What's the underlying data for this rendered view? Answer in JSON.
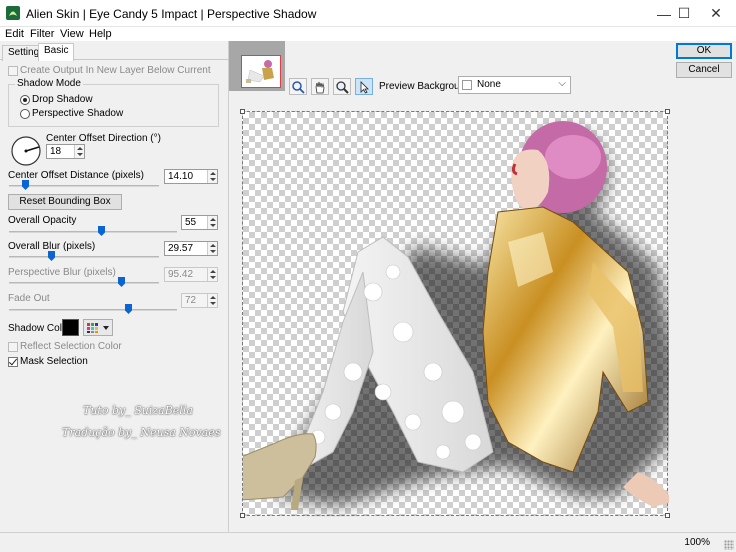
{
  "window": {
    "title": "Alien Skin | Eye Candy 5 Impact | Perspective Shadow",
    "minimize_glyph": "—",
    "maximize_glyph": "☐",
    "close_glyph": "✕"
  },
  "menu": [
    "Edit",
    "Filter",
    "View",
    "Help"
  ],
  "tabs": [
    "Settings",
    "Basic"
  ],
  "basic": {
    "create_output_label": "Create Output In New Layer Below Current",
    "shadow_mode": {
      "legend": "Shadow Mode",
      "options": [
        "Drop Shadow",
        "Perspective Shadow"
      ],
      "selected": "Drop Shadow"
    },
    "center_offset_direction": {
      "label": "Center Offset Direction (°)",
      "value": "18"
    },
    "center_offset_distance": {
      "label": "Center Offset Distance (pixels)",
      "value": "14.10",
      "slider_fraction": 0.09
    },
    "reset_bounding_box_label": "Reset Bounding Box",
    "overall_opacity": {
      "label": "Overall Opacity",
      "value": "55",
      "slider_fraction": 0.55
    },
    "overall_blur": {
      "label": "Overall Blur (pixels)",
      "value": "29.57",
      "slider_fraction": 0.27
    },
    "perspective_blur": {
      "label": "Perspective Blur (pixels)",
      "value": "95.42",
      "slider_fraction": 0.76
    },
    "fade_out": {
      "label": "Fade Out",
      "value": "72",
      "slider_fraction": 0.72
    },
    "shadow_color_label": "Shadow Color",
    "shadow_color": "#000000",
    "reflect_selection_color_label": "Reflect Selection Color",
    "mask_selection_label": "Mask Selection",
    "mask_selection_checked": true
  },
  "preview": {
    "tools": [
      "hand-zoom-icon",
      "hand-pan-icon",
      "magnifier-icon",
      "arrow-pointer-icon"
    ],
    "preview_background_label": "Preview Background:",
    "preview_background_value": "None",
    "watermark_line1": "Tuto by_ SuizaBella",
    "watermark_line2": "Tradução by_ Neusa Novaes"
  },
  "buttons": {
    "ok": "OK",
    "cancel": "Cancel"
  },
  "status": {
    "zoom": "100%"
  },
  "colors": {
    "accent": "#0078d7",
    "slider_thumb": "#0a64d2",
    "selection_frame": "#e04040"
  }
}
